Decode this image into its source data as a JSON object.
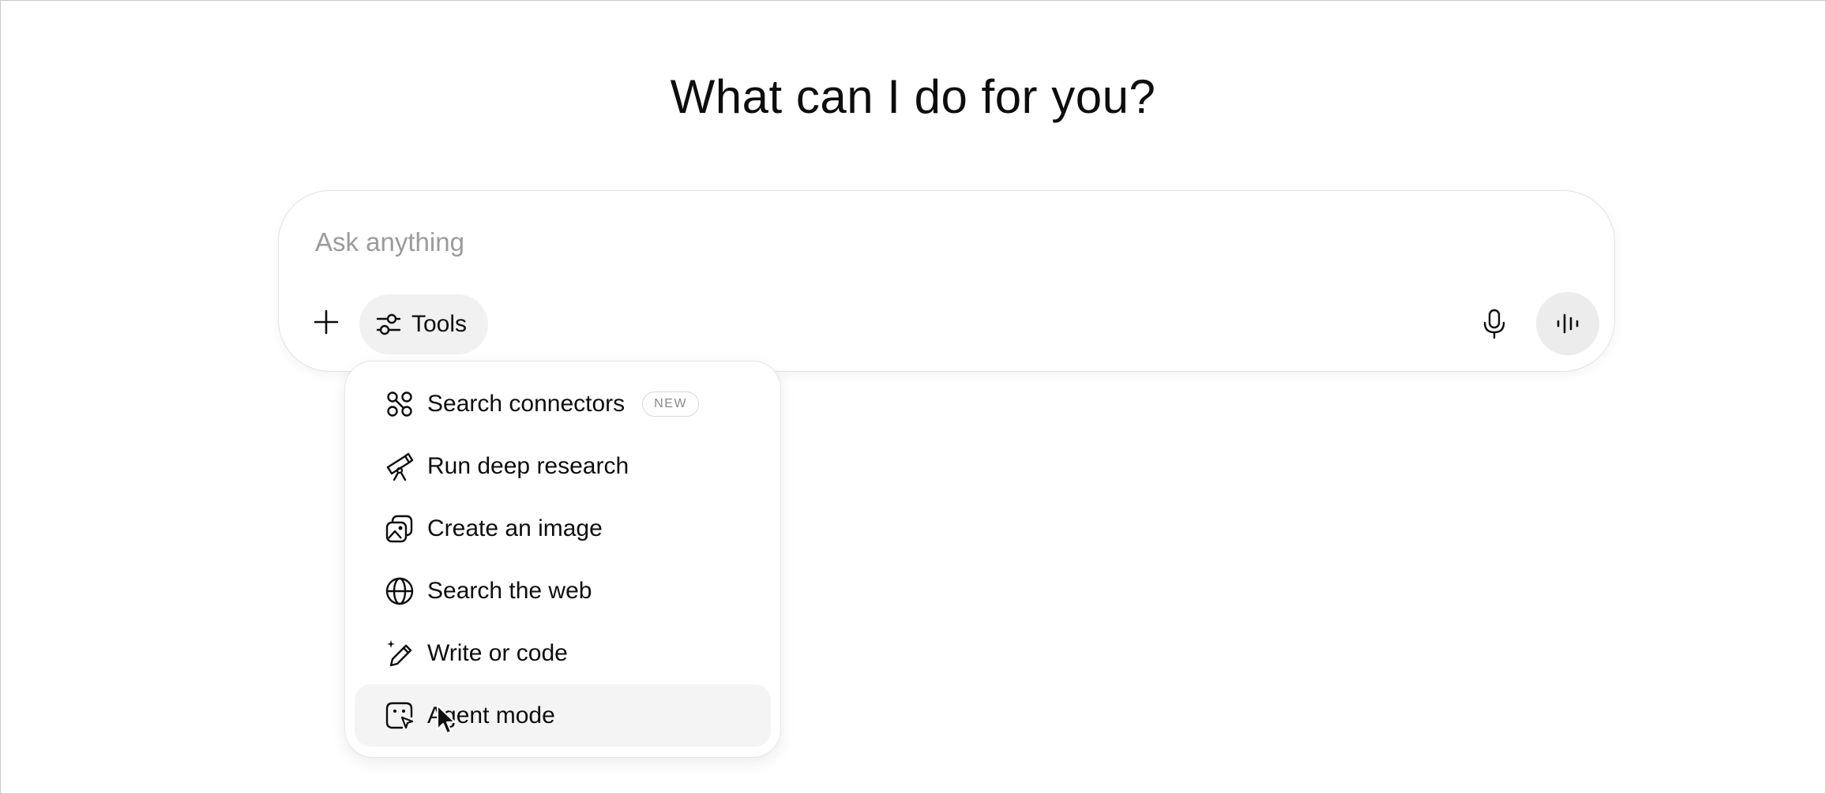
{
  "heading": "What can I do for you?",
  "composer": {
    "placeholder": "Ask anything",
    "value": "",
    "tools_label": "Tools",
    "plus_icon": "plus-icon",
    "tools_icon": "sliders-icon",
    "mic_icon": "microphone-icon",
    "voice_icon": "voice-waveform-icon"
  },
  "tools_menu": {
    "items": [
      {
        "label": "Search connectors",
        "icon": "connectors-icon",
        "badge": "NEW"
      },
      {
        "label": "Run deep research",
        "icon": "telescope-icon"
      },
      {
        "label": "Create an image",
        "icon": "image-icon"
      },
      {
        "label": "Search the web",
        "icon": "globe-icon"
      },
      {
        "label": "Write or code",
        "icon": "pencil-sparkle-icon"
      },
      {
        "label": "Agent mode",
        "icon": "agent-cursor-icon",
        "hovered": true
      }
    ]
  },
  "colors": {
    "text": "#0d0d0d",
    "placeholder": "#9b9b9b",
    "button_bg": "#f1f1f1",
    "hover_bg": "#f4f4f4",
    "border": "#e3e3e3"
  }
}
